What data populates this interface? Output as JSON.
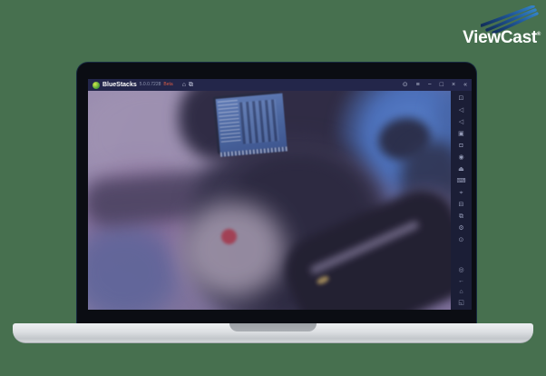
{
  "colors": {
    "page_background": "#47704f",
    "titlebar_background": "#23264a",
    "sidebar_background": "#1b1e36",
    "beta_badge": "#d85a45",
    "logo_swoosh_navy": "#122f5a",
    "logo_swoosh_blue": "#3381c6",
    "record_dot": "#a93a4b",
    "laptop_base": "#dcdfe2"
  },
  "viewcast": {
    "wordmark": "ViewCast",
    "registered_mark": "®"
  },
  "bluestacks": {
    "titlebar": {
      "app_name": "BlueStacks",
      "version": "5.0.0.7228",
      "beta_label": "Beta",
      "left_icons": [
        {
          "name": "home-icon",
          "glyph": "⌂"
        },
        {
          "name": "multi-window-icon",
          "glyph": "⧉"
        }
      ],
      "right_icons": [
        {
          "name": "power-icon",
          "glyph": "⊙"
        },
        {
          "name": "menu-icon",
          "glyph": "≡"
        },
        {
          "name": "minimize-icon",
          "glyph": "−"
        },
        {
          "name": "maximize-icon",
          "glyph": "□"
        },
        {
          "name": "close-icon",
          "glyph": "×"
        },
        {
          "name": "collapse-sidebar-icon",
          "glyph": "«"
        }
      ]
    },
    "sidebar": {
      "top_icons": [
        {
          "name": "fullscreen-icon",
          "glyph": "⊡"
        },
        {
          "name": "volume-up-icon",
          "glyph": "◁"
        },
        {
          "name": "volume-down-icon",
          "glyph": "◁"
        },
        {
          "name": "screenshot-icon",
          "glyph": "▣"
        },
        {
          "name": "screen-recorder-icon",
          "glyph": "◘"
        },
        {
          "name": "location-icon",
          "glyph": "◉"
        },
        {
          "name": "shake-icon",
          "glyph": "⏏"
        },
        {
          "name": "game-controls-icon",
          "glyph": "⌨"
        },
        {
          "name": "crosshair-icon",
          "glyph": "⌖"
        },
        {
          "name": "media-manager-icon",
          "glyph": "⊟"
        },
        {
          "name": "multi-instance-icon",
          "glyph": "⧉"
        },
        {
          "name": "settings-icon",
          "glyph": "⚙"
        },
        {
          "name": "more-icon",
          "glyph": "⊙"
        }
      ],
      "bottom_icons": [
        {
          "name": "macro-recorder-icon",
          "glyph": "◎"
        },
        {
          "name": "back-icon",
          "glyph": "←"
        },
        {
          "name": "home-nav-icon",
          "glyph": "⌂"
        },
        {
          "name": "recent-apps-icon",
          "glyph": "◱"
        }
      ]
    }
  }
}
